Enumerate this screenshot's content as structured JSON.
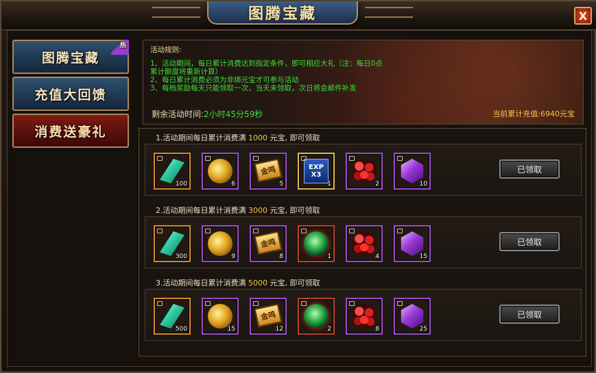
{
  "window": {
    "title": "图腾宝藏",
    "close_label": "X",
    "top_text": "...",
    "top_text2": "..."
  },
  "sidebar": {
    "items": [
      {
        "label": "图腾宝藏",
        "badge": "热",
        "active": false
      },
      {
        "label": "充值大回馈",
        "active": false
      },
      {
        "label": "消费送豪礼",
        "active": true
      }
    ]
  },
  "rules": {
    "heading": "活动规则:",
    "lines": [
      "1、活动期间，每日累计消费达到指定条件，即可相应大礼（注：每日0点",
      "累计额度将重新计算）",
      "2、每日累计消费必须为非绑元宝才可参与活动",
      "3、每档奖励每天只能领取一次，当天未领取，次日将会邮件补发"
    ],
    "remain_label": "剩余活动时间:",
    "remain_value": "2小时45分59秒",
    "total_label": "当前累计充值:6940元宝"
  },
  "tiers": [
    {
      "prefix": "1.活动期间每日累计消费满",
      "amount": "1000",
      "suffix": "元宝, 即可领取",
      "claim_label": "已领取",
      "items": [
        {
          "icon": "crystal-icon",
          "count": "100"
        },
        {
          "icon": "gold-ingot-icon",
          "count": "6"
        },
        {
          "icon": "gold-token-icon",
          "count": "5"
        },
        {
          "icon": "exp-x3-icon",
          "count": "1"
        },
        {
          "icon": "rose-bouquet-icon",
          "count": "2"
        },
        {
          "icon": "purple-gem-icon",
          "count": "10"
        }
      ]
    },
    {
      "prefix": "2.活动期间每日累计消费满",
      "amount": "3000",
      "suffix": "元宝, 即可领取",
      "claim_label": "已领取",
      "items": [
        {
          "icon": "crystal-icon",
          "count": "300"
        },
        {
          "icon": "gold-ingot-icon",
          "count": "9"
        },
        {
          "icon": "gold-token-icon",
          "count": "8"
        },
        {
          "icon": "green-orb-icon",
          "count": "1"
        },
        {
          "icon": "rose-bouquet-icon",
          "count": "4"
        },
        {
          "icon": "purple-gem-icon",
          "count": "15"
        }
      ]
    },
    {
      "prefix": "3.活动期间每日累计消费满",
      "amount": "5000",
      "suffix": "元宝, 即可领取",
      "claim_label": "已领取",
      "items": [
        {
          "icon": "crystal-icon",
          "count": "500"
        },
        {
          "icon": "gold-ingot-icon",
          "count": "15"
        },
        {
          "icon": "gold-token-icon",
          "count": "12"
        },
        {
          "icon": "green-orb-icon",
          "count": "2"
        },
        {
          "icon": "rose-bouquet-icon",
          "count": "8"
        },
        {
          "icon": "purple-gem-icon",
          "count": "25"
        }
      ]
    }
  ],
  "token_glyph": "金鸣",
  "exp_glyph": {
    "top": "EXP",
    "bottom": "X3"
  }
}
